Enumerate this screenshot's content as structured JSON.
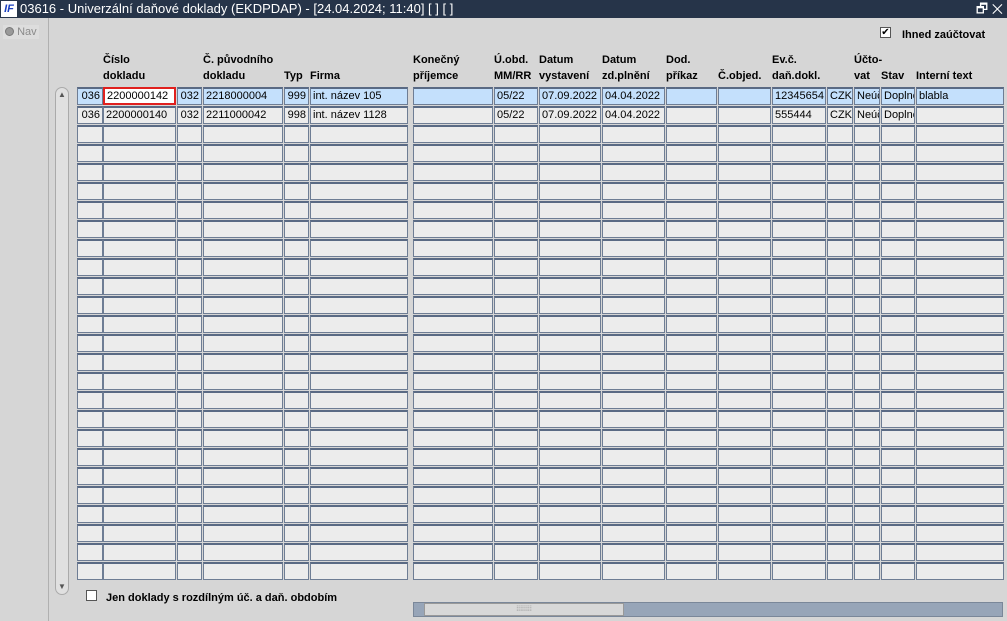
{
  "window": {
    "title": "03616 - Univerzální daňové doklady (EKDPDAP) - [24.04.2024; 11:40]  [ ]  [ ]",
    "logo": "IF",
    "restore": "🗗",
    "close": "✕"
  },
  "nav": {
    "label": "Nav"
  },
  "immediate_post": {
    "label": "Ihned zaúčtovat",
    "checked": true
  },
  "filter": {
    "label": "Jen doklady s rozdílným úč. a daň. obdobím",
    "checked": false
  },
  "headers": [
    "",
    "Číslo\ndokladu",
    "",
    "Č. původního\ndokladu",
    "Typ",
    "Firma",
    "Konečný\npříjemce",
    "Ú.obd.\nMM/RR",
    "Datum\nvystavení",
    "Datum\nzd.plnění",
    "Dod.\npříkaz",
    "Č.objed.",
    "Ev.č.\ndaň.dokl.",
    "",
    "Účto-\nvat",
    "Stav",
    "Interní text"
  ],
  "rows": [
    [
      "036",
      "2200000142",
      "032",
      "2218000004",
      "999",
      "int. název 105",
      "",
      "05/22",
      "07.09.2022",
      "04.04.2022",
      "",
      "",
      "12345654",
      "CZK",
      "Neúč",
      "Doplně",
      "blabla"
    ],
    [
      "036",
      "2200000140",
      "032",
      "2211000042",
      "998",
      "int. název 1128",
      "",
      "05/22",
      "07.09.2022",
      "04.04.2022",
      "",
      "",
      "555444",
      "CZK",
      "Neúč",
      "Doplně",
      ""
    ]
  ],
  "empty_row_count": 24,
  "colors": {
    "selected_row": "#c4e0fc",
    "focus_border": "#e0201e",
    "titlebar": "#263449"
  }
}
